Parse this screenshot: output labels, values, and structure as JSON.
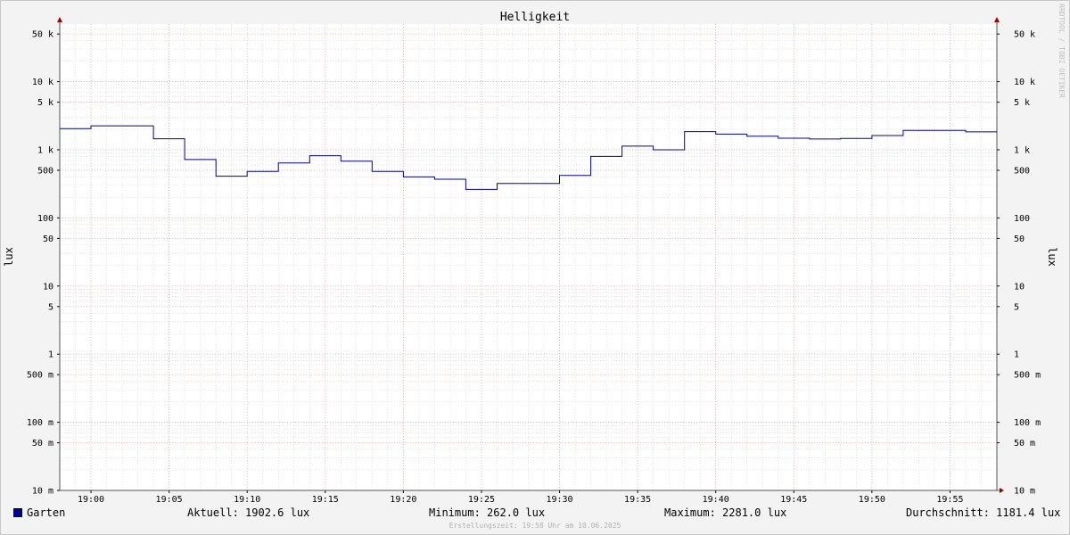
{
  "watermark": "RRDTOOL / TOBI OETIKER",
  "footer": "Erstellungszeit: 19:58 Uhr am 10.06.2025",
  "colors": {
    "series": "#0000a0",
    "plot_bg": "#ffffff",
    "canvas_bg": "#f3f3f3",
    "major_grid": "#e89a9a",
    "minor_grid": "#c9c9c9"
  },
  "legend": {
    "series_name": "Garten",
    "current": "Aktuell: 1902.6 lux",
    "minimum": "Minimum: 262.0 lux",
    "maximum": "Maximum: 2281.0 lux",
    "average": "Durchschnitt: 1181.4 lux"
  },
  "chart_data": {
    "type": "line",
    "title": "Helligkeit",
    "ylabel": "lux",
    "ylabel_right": "lux",
    "y_scale": "log",
    "ylim": [
      0.01,
      70000
    ],
    "xlim": [
      "18:58",
      "19:58"
    ],
    "x_ticks": [
      "19:00",
      "19:05",
      "19:10",
      "19:15",
      "19:20",
      "19:25",
      "19:30",
      "19:35",
      "19:40",
      "19:45",
      "19:50",
      "19:55"
    ],
    "y_ticks": [
      {
        "value": 0.01,
        "label": "10 m"
      },
      {
        "value": 0.05,
        "label": "50 m"
      },
      {
        "value": 0.1,
        "label": "100 m"
      },
      {
        "value": 0.5,
        "label": "500 m"
      },
      {
        "value": 1,
        "label": "1"
      },
      {
        "value": 5,
        "label": "5"
      },
      {
        "value": 10,
        "label": "10"
      },
      {
        "value": 50,
        "label": "50"
      },
      {
        "value": 100,
        "label": "100"
      },
      {
        "value": 500,
        "label": "500"
      },
      {
        "value": 1000,
        "label": "1 k"
      },
      {
        "value": 5000,
        "label": "5 k"
      },
      {
        "value": 10000,
        "label": "10 k"
      },
      {
        "value": 50000,
        "label": "50 k"
      }
    ],
    "grid": true,
    "series": [
      {
        "name": "Garten",
        "step": true,
        "points": [
          [
            "18:58",
            2050
          ],
          [
            "19:00",
            2250
          ],
          [
            "19:04",
            1450
          ],
          [
            "19:06",
            720
          ],
          [
            "19:08",
            410
          ],
          [
            "19:10",
            480
          ],
          [
            "19:12",
            640
          ],
          [
            "19:14",
            820
          ],
          [
            "19:16",
            680
          ],
          [
            "19:18",
            480
          ],
          [
            "19:20",
            400
          ],
          [
            "19:22",
            370
          ],
          [
            "19:24",
            262
          ],
          [
            "19:26",
            320
          ],
          [
            "19:30",
            420
          ],
          [
            "19:32",
            800
          ],
          [
            "19:34",
            1130
          ],
          [
            "19:36",
            1000
          ],
          [
            "19:38",
            1850
          ],
          [
            "19:40",
            1700
          ],
          [
            "19:42",
            1580
          ],
          [
            "19:44",
            1480
          ],
          [
            "19:46",
            1440
          ],
          [
            "19:48",
            1470
          ],
          [
            "19:50",
            1620
          ],
          [
            "19:52",
            1920
          ],
          [
            "19:56",
            1830
          ],
          [
            "19:58",
            1830
          ]
        ]
      }
    ]
  }
}
